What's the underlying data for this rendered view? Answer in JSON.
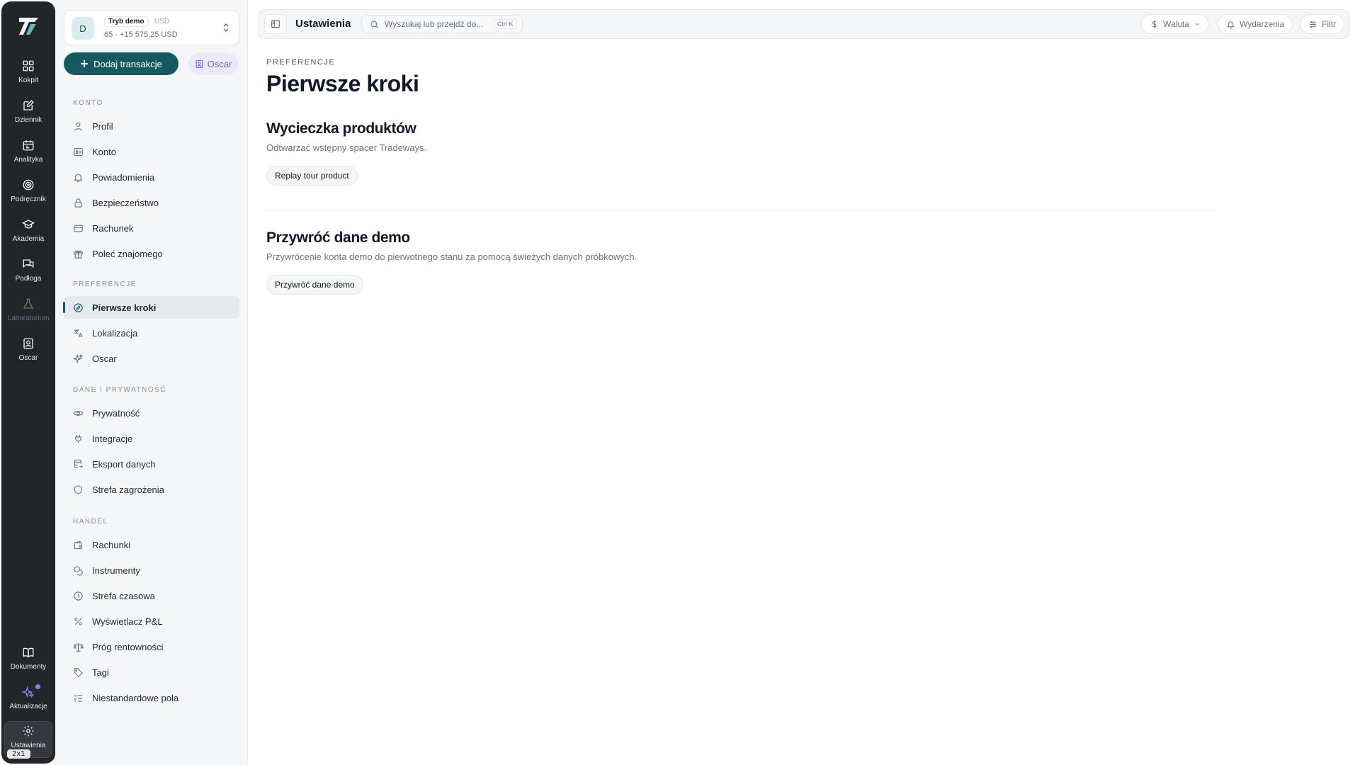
{
  "rail": {
    "items": [
      {
        "label": "Kokpit",
        "icon": "dashboard-icon"
      },
      {
        "label": "Dziennik",
        "icon": "journal-icon"
      },
      {
        "label": "Analityka",
        "icon": "calendar-icon"
      },
      {
        "label": "Podręcznik",
        "icon": "target-icon"
      },
      {
        "label": "Akademia",
        "icon": "graduation-cap-icon"
      },
      {
        "label": "Podłoga",
        "icon": "chat-icon"
      },
      {
        "label": "Laboratorium",
        "icon": "flask-icon"
      },
      {
        "label": "Oscar",
        "icon": "assistant-icon"
      }
    ],
    "bottom_items": [
      {
        "label": "Dokumenty",
        "icon": "book-icon"
      },
      {
        "label": "Aktualizacje",
        "icon": "sparkles-icon"
      },
      {
        "label": "Ustawienia",
        "icon": "gear-icon"
      }
    ],
    "badge": "2x1"
  },
  "account": {
    "avatar": "D",
    "mode": "Tryb demo",
    "currency": "USD",
    "balance": "65 · +15 575,25 USD"
  },
  "actions": {
    "add_label": "Dodaj transakcje",
    "oscar_label": "Oscar"
  },
  "sidebar": {
    "sections": [
      {
        "title": "KONTO",
        "items": [
          "Profil",
          "Konto",
          "Powiadomienia",
          "Bezpieczeństwo",
          "Rachunek",
          "Poleć znajomego"
        ]
      },
      {
        "title": "PREFERENCJE",
        "items": [
          "Pierwsze kroki",
          "Lokalizacja",
          "Oscar"
        ]
      },
      {
        "title": "DANE I PRYWATNOŚĆ",
        "items": [
          "Prywatność",
          "Integracje",
          "Eksport danych",
          "Strefa zagrożenia"
        ]
      },
      {
        "title": "HANDEL",
        "items": [
          "Rachunki",
          "Instrumenty",
          "Strefa czasowa",
          "Wyświetlacz P&L",
          "Próg rentowności",
          "Tagi",
          "Niestandardowe pola"
        ]
      }
    ],
    "active_item": "Pierwsze kroki"
  },
  "topbar": {
    "title": "Ustawienia",
    "search_placeholder": "Wyszukaj lub przejdź do...",
    "shortcut": "Ctrl K",
    "currency_label": "Waluta",
    "events_label": "Wydarzenia",
    "filter_label": "Filtr"
  },
  "main": {
    "eyebrow": "PREFERENCJE",
    "title": "Pierwsze kroki",
    "tour": {
      "heading": "Wycieczka produktów",
      "description": "Odtwarzać wstępny spacer Tradeways.",
      "button": "Replay tour product"
    },
    "demo": {
      "heading": "Przywróć dane demo",
      "description": "Przywrócenie konta demo do pierwotnego stanu za pomocą świeżych danych próbkowych.",
      "button": "Przywróć dane demo"
    }
  },
  "colors": {
    "rail_bg": "#232629",
    "accent": "#16585f",
    "oscar_accent": "#7b62c9",
    "sidebar_bg": "#f5f6f7"
  }
}
